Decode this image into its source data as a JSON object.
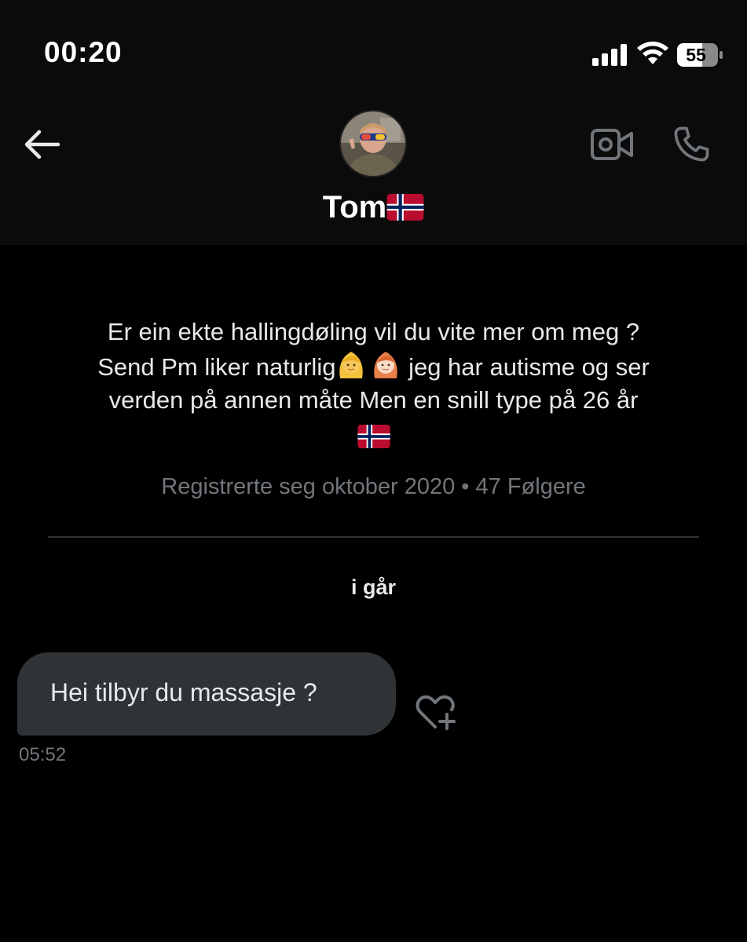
{
  "status_bar": {
    "time": "00:20",
    "battery_level": "55"
  },
  "header": {
    "contact_name": "Tom",
    "icons": {
      "back": "arrow-left-icon",
      "video": "video-camera-icon",
      "call": "phone-icon",
      "flag": "norway-flag-icon"
    }
  },
  "bio": {
    "line1": "Er ein ekte hallingdøling vil du vite mer om meg ?",
    "line2_a": "Send Pm liker naturlig",
    "line2_b": " jeg har autisme og ser",
    "line3": "verden på annen måte Men en snill type på  26 år"
  },
  "meta": {
    "text": "Registrerte seg oktober 2020 • 47 Følgere"
  },
  "conversation": {
    "date_separator": "i går",
    "messages": [
      {
        "text": "Hei tilbyr du massasje ?",
        "time": "05:52"
      }
    ]
  },
  "colors": {
    "background": "#000000",
    "header_background": "#0b0b0b",
    "bubble": "#2f3336",
    "muted_text": "#71767b",
    "icon_grey": "#71767b"
  }
}
